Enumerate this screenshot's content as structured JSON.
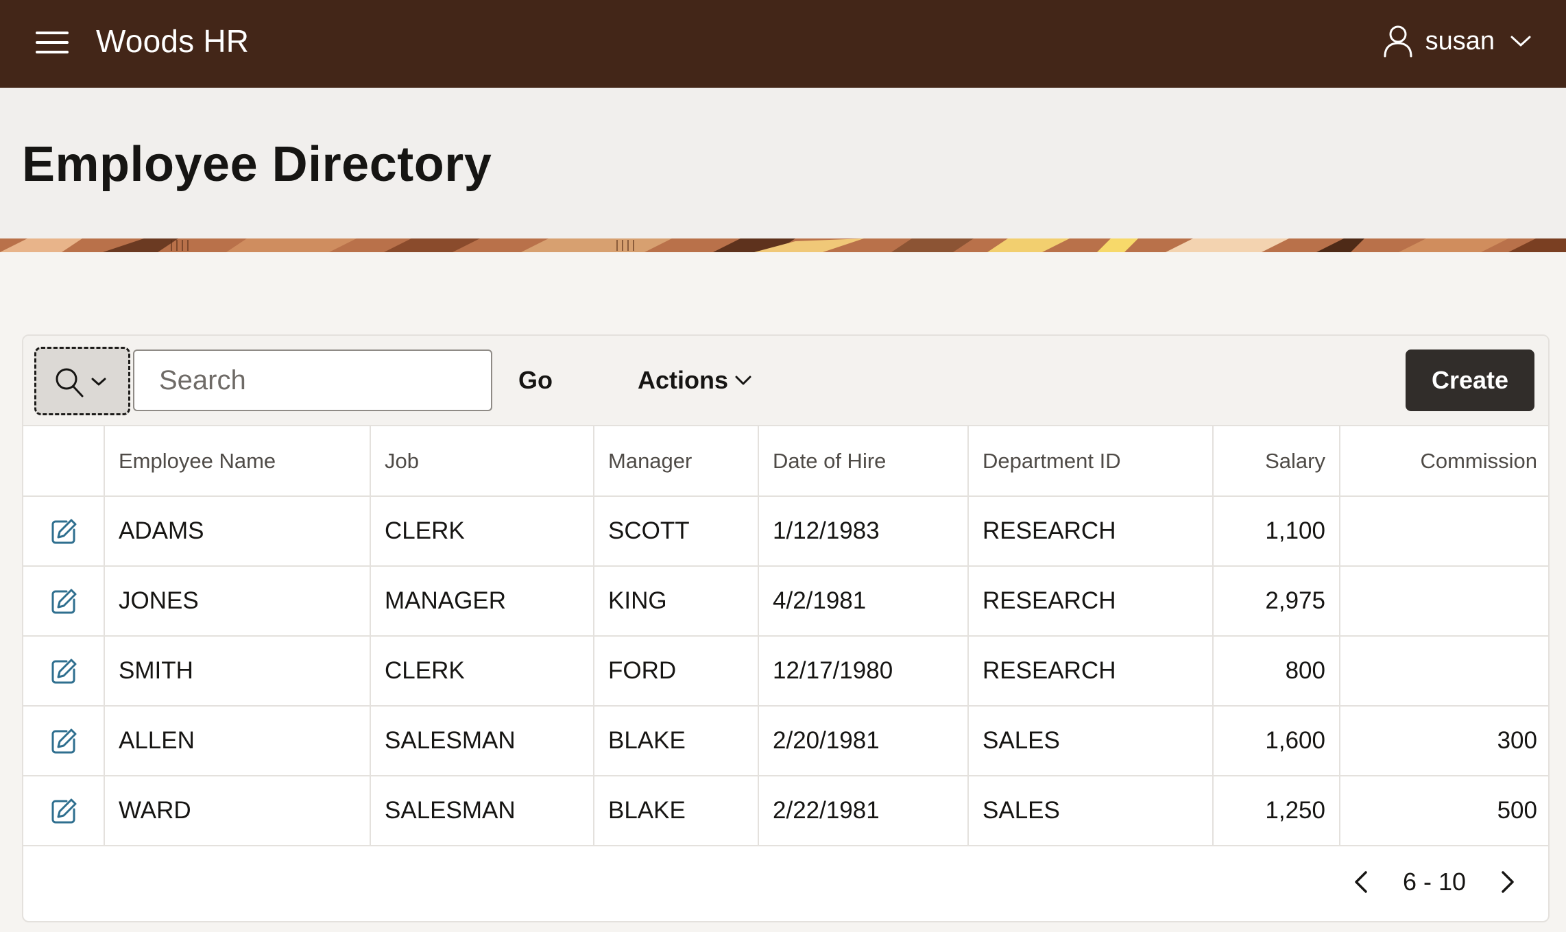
{
  "header": {
    "app_title": "Woods HR",
    "user_name": "susan",
    "menu_icon": "hamburger-menu-icon",
    "user_icon": "user-icon",
    "background_color": "#432618"
  },
  "page": {
    "title": "Employee Directory"
  },
  "toolbar": {
    "search_placeholder": "Search",
    "search_value": "",
    "go_label": "Go",
    "actions_label": "Actions",
    "create_label": "Create"
  },
  "table": {
    "columns": [
      "Employee Name",
      "Job",
      "Manager",
      "Date of Hire",
      "Department ID",
      "Salary",
      "Commission"
    ],
    "rows": [
      {
        "name": "ADAMS",
        "job": "CLERK",
        "manager": "SCOTT",
        "hire_date": "1/12/1983",
        "department": "RESEARCH",
        "salary": "1,100",
        "commission": ""
      },
      {
        "name": "JONES",
        "job": "MANAGER",
        "manager": "KING",
        "hire_date": "4/2/1981",
        "department": "RESEARCH",
        "salary": "2,975",
        "commission": ""
      },
      {
        "name": "SMITH",
        "job": "CLERK",
        "manager": "FORD",
        "hire_date": "12/17/1980",
        "department": "RESEARCH",
        "salary": "800",
        "commission": ""
      },
      {
        "name": "ALLEN",
        "job": "SALESMAN",
        "manager": "BLAKE",
        "hire_date": "2/20/1981",
        "department": "SALES",
        "salary": "1,600",
        "commission": "300"
      },
      {
        "name": "WARD",
        "job": "SALESMAN",
        "manager": "BLAKE",
        "hire_date": "2/22/1981",
        "department": "SALES",
        "salary": "1,250",
        "commission": "500"
      }
    ]
  },
  "pagination": {
    "range": "6 - 10"
  },
  "colors": {
    "accent_dark": "#312d2a",
    "edit_icon": "#2f6f8f",
    "page_background": "#f6f4f1"
  }
}
